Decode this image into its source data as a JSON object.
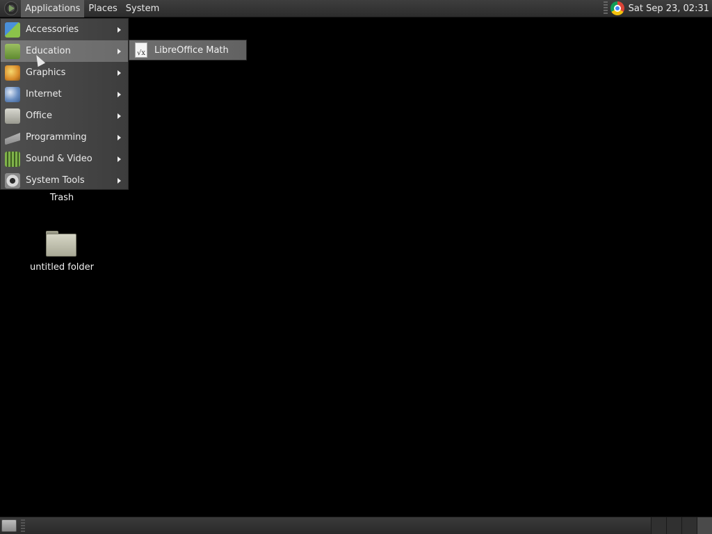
{
  "top_panel": {
    "menus": [
      {
        "label": "Applications",
        "active": true
      },
      {
        "label": "Places",
        "active": false
      },
      {
        "label": "System",
        "active": false
      }
    ],
    "clock": "Sat Sep 23, 02:31"
  },
  "applications_menu": {
    "items": [
      {
        "label": "Accessories",
        "icon": "accessories-icon",
        "selected": false
      },
      {
        "label": "Education",
        "icon": "education-icon",
        "selected": true
      },
      {
        "label": "Graphics",
        "icon": "graphics-icon",
        "selected": false
      },
      {
        "label": "Internet",
        "icon": "internet-icon",
        "selected": false
      },
      {
        "label": "Office",
        "icon": "office-icon",
        "selected": false
      },
      {
        "label": "Programming",
        "icon": "programming-icon",
        "selected": false
      },
      {
        "label": "Sound & Video",
        "icon": "sound-video-icon",
        "selected": false
      },
      {
        "label": "System Tools",
        "icon": "system-tools-icon",
        "selected": false
      }
    ]
  },
  "education_submenu": {
    "items": [
      {
        "label": "LibreOffice Math",
        "icon": "libreoffice-math-icon",
        "icon_glyph": "√x"
      }
    ]
  },
  "desktop": {
    "icons": [
      {
        "label": "Trash",
        "icon": "trash-icon"
      },
      {
        "label": "untitled folder",
        "icon": "folder-icon"
      }
    ]
  }
}
